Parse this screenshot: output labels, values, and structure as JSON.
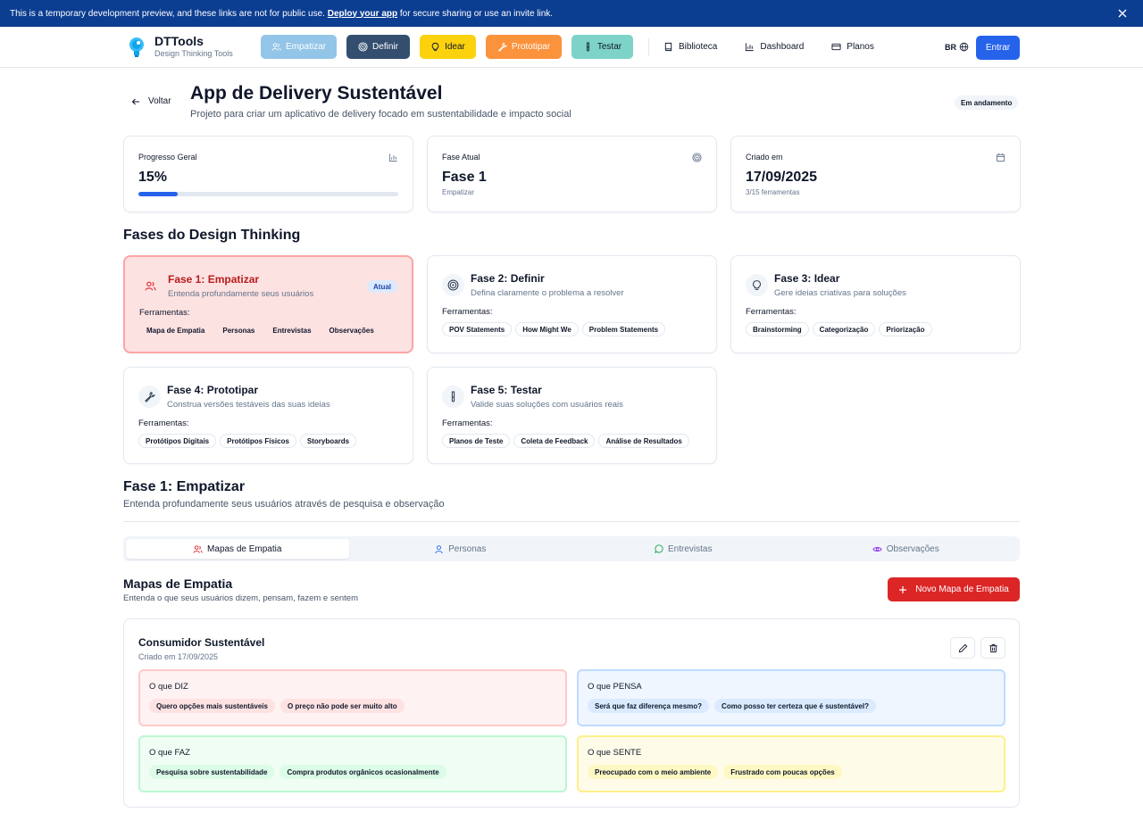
{
  "banner": {
    "text": "This is a temporary development preview, and these links are not for public use.",
    "link": "Deploy your app",
    "suffix": "for secure sharing or use an invite link."
  },
  "nav": {
    "brand_title": "DTTools",
    "brand_sub": "Design Thinking Tools",
    "phases": [
      {
        "label": "Empatizar",
        "bg": "#93c5e8",
        "fg": "#ffffff",
        "icon": "users-icon"
      },
      {
        "label": "Definir",
        "bg": "#334e6f",
        "fg": "#ffffff",
        "icon": "target-icon"
      },
      {
        "label": "Idear",
        "bg": "#fcd20f",
        "fg": "#0f172a",
        "icon": "lightbulb-icon"
      },
      {
        "label": "Prototipar",
        "bg": "#fb923c",
        "fg": "#ffffff",
        "icon": "wrench-icon"
      },
      {
        "label": "Testar",
        "bg": "#7dd3c7",
        "fg": "#0f172a",
        "icon": "test-tube-icon"
      }
    ],
    "links": [
      {
        "label": "Biblioteca",
        "icon": "book-icon"
      },
      {
        "label": "Dashboard",
        "icon": "bar-chart-icon"
      },
      {
        "label": "Planos",
        "icon": "credit-card-icon"
      }
    ],
    "lang": "BR",
    "login": "Entrar"
  },
  "header": {
    "back": "Voltar",
    "title": "App de Delivery Sustentável",
    "subtitle": "Projeto para criar um aplicativo de delivery focado em sustentabilidade e impacto social",
    "status": "Em andamento"
  },
  "stats": {
    "progress": {
      "label": "Progresso Geral",
      "value": "15%",
      "fraction": 0.15
    },
    "phase": {
      "label": "Fase Atual",
      "value": "Fase 1",
      "sub": "Empatizar"
    },
    "created": {
      "label": "Criado em",
      "value": "17/09/2025",
      "sub": "3/15 ferramentas"
    }
  },
  "phases_section": {
    "title": "Fases do Design Thinking",
    "tools_label": "Ferramentas:",
    "current_badge": "Atual",
    "cards": [
      {
        "title": "Fase 1: Empatizar",
        "desc": "Entenda profundamente seus usuários",
        "tools": [
          "Mapa de Empatia",
          "Personas",
          "Entrevistas",
          "Observações"
        ]
      },
      {
        "title": "Fase 2: Definir",
        "desc": "Defina claramente o problema a resolver",
        "tools": [
          "POV Statements",
          "How Might We",
          "Problem Statements"
        ]
      },
      {
        "title": "Fase 3: Idear",
        "desc": "Gere ideias criativas para soluções",
        "tools": [
          "Brainstorming",
          "Categorização",
          "Priorização"
        ]
      },
      {
        "title": "Fase 4: Prototipar",
        "desc": "Construa versões testáveis das suas ideias",
        "tools": [
          "Protótipos Digitais",
          "Protótipos Físicos",
          "Storyboards"
        ]
      },
      {
        "title": "Fase 5: Testar",
        "desc": "Valide suas soluções com usuários reais",
        "tools": [
          "Planos de Teste",
          "Coleta de Feedback",
          "Análise de Resultados"
        ]
      }
    ]
  },
  "phase_detail": {
    "title": "Fase 1: Empatizar",
    "desc": "Entenda profundamente seus usuários através de pesquisa e observação",
    "tabs": [
      {
        "label": "Mapas de Empatia",
        "icon": "users-icon",
        "color": "#dc2626"
      },
      {
        "label": "Personas",
        "icon": "user-icon",
        "color": "#2563eb"
      },
      {
        "label": "Entrevistas",
        "icon": "message-circle-icon",
        "color": "#16a34a"
      },
      {
        "label": "Observações",
        "icon": "eye-icon",
        "color": "#9333ea"
      }
    ]
  },
  "maps": {
    "title": "Mapas de Empatia",
    "desc": "Entenda o que seus usuários dizem, pensam, fazem e sentem",
    "new_button": "Novo Mapa de Empatia",
    "card": {
      "title": "Consumidor Sustentável",
      "date": "Criado em 17/09/2025",
      "quadrants": [
        {
          "title": "O que DIZ",
          "bg": "#fef2f2",
          "border": "#fecaca",
          "tag_bg": "#fee2e2",
          "tags": [
            "Quero opções mais sustentáveis",
            "O preço não pode ser muito alto"
          ]
        },
        {
          "title": "O que PENSA",
          "bg": "#eff6ff",
          "border": "#bfdbfe",
          "tag_bg": "#dbeafe",
          "tags": [
            "Será que faz diferença mesmo?",
            "Como posso ter certeza que é sustentável?"
          ]
        },
        {
          "title": "O que FAZ",
          "bg": "#f0fdf4",
          "border": "#bbf7d0",
          "tag_bg": "#dcfce7",
          "tags": [
            "Pesquisa sobre sustentabilidade",
            "Compra produtos orgânicos ocasionalmente"
          ]
        },
        {
          "title": "O que SENTE",
          "bg": "#fefce8",
          "border": "#fef08a",
          "tag_bg": "#fef9c3",
          "tags": [
            "Preocupado com o meio ambiente",
            "Frustrado com poucas opções"
          ]
        }
      ]
    }
  }
}
